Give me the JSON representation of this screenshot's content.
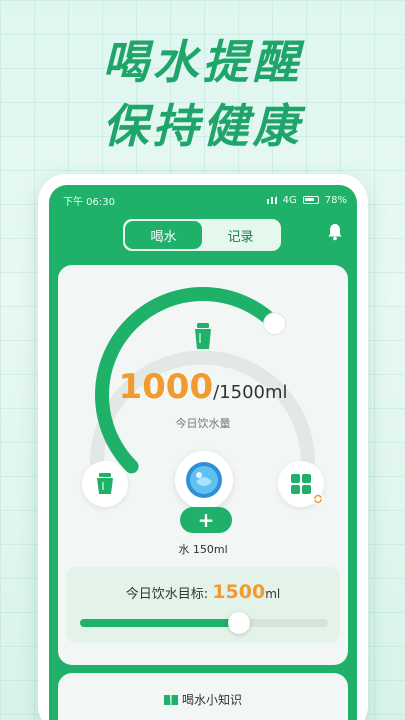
{
  "headline": {
    "line1": "喝水提醒",
    "line2": "保持健康"
  },
  "status_bar": {
    "time": "下午 06:30",
    "network": "4G",
    "battery": "78%"
  },
  "tabs": [
    {
      "label": "喝水",
      "active": true
    },
    {
      "label": "记录",
      "active": false
    }
  ],
  "bell_icon": "bell-icon",
  "intake": {
    "current": "1000",
    "total": "/1500ml",
    "label": "今日饮水量",
    "progress": 0.667
  },
  "quick_add": {
    "button": "+",
    "label": "水 150ml"
  },
  "goal": {
    "label": "今日饮水目标:",
    "value": "1500",
    "unit": "ml",
    "slider_fraction": 0.64
  },
  "tips": {
    "title": "喝水小知识"
  },
  "colors": {
    "brand": "#1fb06a",
    "accent": "#f29a2e"
  }
}
